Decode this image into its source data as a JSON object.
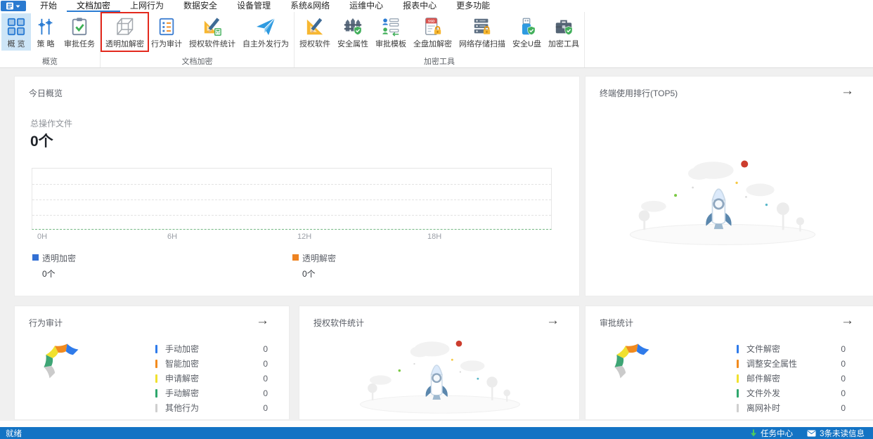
{
  "app": {
    "caret": "▾"
  },
  "menu_tabs": [
    {
      "label": "开始",
      "active": false
    },
    {
      "label": "文档加密",
      "active": true
    },
    {
      "label": "上网行为",
      "active": false
    },
    {
      "label": "数据安全",
      "active": false
    },
    {
      "label": "设备管理",
      "active": false
    },
    {
      "label": "系统&网络",
      "active": false
    },
    {
      "label": "运维中心",
      "active": false
    },
    {
      "label": "报表中心",
      "active": false
    },
    {
      "label": "更多功能",
      "active": false
    }
  ],
  "ribbon": {
    "groups": [
      {
        "label": "概览",
        "items": [
          {
            "label": "概 览",
            "icon": "overview-grid-icon",
            "selected": true
          },
          {
            "label": "策 略",
            "icon": "policy-sliders-icon"
          },
          {
            "label": "审批任务",
            "icon": "approval-task-clipboard-icon"
          }
        ]
      },
      {
        "label": "文档加密",
        "items": [
          {
            "label": "透明加解密",
            "icon": "transparent-crypt-cube-icon",
            "highlighted": true
          },
          {
            "label": "行为审计",
            "icon": "behavior-audit-list-icon"
          },
          {
            "label": "授权软件统计",
            "icon": "licensed-software-stats-icon"
          },
          {
            "label": "自主外发行为",
            "icon": "outgoing-paper-plane-icon"
          }
        ]
      },
      {
        "label": "加密工具",
        "items": [
          {
            "label": "授权软件",
            "icon": "licensed-software-icon"
          },
          {
            "label": "安全属性",
            "icon": "security-attribute-fence-icon"
          },
          {
            "label": "审批模板",
            "icon": "approval-template-icon"
          },
          {
            "label": "全盘加解密",
            "icon": "full-disk-crypt-icon"
          },
          {
            "label": "网络存储扫描",
            "icon": "network-storage-scan-icon"
          },
          {
            "label": "安全U盘",
            "icon": "secure-usb-icon"
          },
          {
            "label": "加密工具",
            "icon": "crypt-toolbox-icon"
          }
        ]
      }
    ]
  },
  "panels": {
    "today": {
      "title": "今日概览",
      "metric_label": "总操作文件",
      "metric_value": "0个",
      "x_ticks": [
        "0H",
        "6H",
        "12H",
        "18H"
      ],
      "legend": [
        {
          "label": "透明加密",
          "value": "0个",
          "color": "#3370d4"
        },
        {
          "label": "透明解密",
          "value": "0个",
          "color": "#ee8322"
        }
      ]
    },
    "terminal_rank": {
      "title": "终端使用排行(TOP5)",
      "arrow": "→"
    },
    "behavior_audit": {
      "title": "行为审计",
      "arrow": "→",
      "legend": [
        {
          "label": "手动加密",
          "value": "0",
          "color": "#2f7bea"
        },
        {
          "label": "智能加密",
          "value": "0",
          "color": "#f28b1e"
        },
        {
          "label": "申请解密",
          "value": "0",
          "color": "#f0e12f"
        },
        {
          "label": "手动解密",
          "value": "0",
          "color": "#2fa76d"
        },
        {
          "label": "其他行为",
          "value": "0",
          "color": "#cfcfcf"
        }
      ]
    },
    "software_stats": {
      "title": "授权软件统计",
      "arrow": "→"
    },
    "approval_stats": {
      "title": "审批统计",
      "arrow": "→",
      "legend": [
        {
          "label": "文件解密",
          "value": "0",
          "color": "#2f7bea"
        },
        {
          "label": "调整安全属性",
          "value": "0",
          "color": "#f28b1e"
        },
        {
          "label": "邮件解密",
          "value": "0",
          "color": "#f0e12f"
        },
        {
          "label": "文件外发",
          "value": "0",
          "color": "#2fa76d"
        },
        {
          "label": "离网补时",
          "value": "0",
          "color": "#cfcfcf"
        }
      ]
    }
  },
  "status_bar": {
    "ready": "就绪",
    "task_center": "任务中心",
    "unread": "3条未读信息"
  },
  "colors": {
    "accent": "#2b7cd3",
    "status_bar": "#1373c4",
    "highlight_box": "#e3291d",
    "selected_item_bg": "#cde5f7",
    "gauge_palette": [
      "#cfcfcf",
      "#2fa76d",
      "#f0e12f",
      "#f28b1e",
      "#2f7bea"
    ]
  },
  "chart_data": [
    {
      "type": "line",
      "title": "今日概览",
      "xlabel": "",
      "ylabel": "",
      "x_ticks": [
        "0H",
        "6H",
        "12H",
        "18H"
      ],
      "x_range": [
        "0H",
        "24H"
      ],
      "grid": true,
      "series": [
        {
          "name": "透明加密",
          "color": "#3370d4",
          "values": [],
          "total": 0
        },
        {
          "name": "透明解密",
          "color": "#ee8322",
          "values": [],
          "total": 0
        }
      ],
      "note": "empty chart, no data plotted"
    },
    {
      "type": "pie",
      "title": "行为审计",
      "subtype": "gauge-arc",
      "legend_position": "right",
      "categories": [
        "手动加密",
        "智能加密",
        "申请解密",
        "手动解密",
        "其他行为"
      ],
      "values": [
        0,
        0,
        0,
        0,
        0
      ],
      "colors": [
        "#2f7bea",
        "#f28b1e",
        "#f0e12f",
        "#2fa76d",
        "#cfcfcf"
      ]
    },
    {
      "type": "pie",
      "title": "审批统计",
      "subtype": "gauge-arc",
      "legend_position": "right",
      "categories": [
        "文件解密",
        "调整安全属性",
        "邮件解密",
        "文件外发",
        "离网补时"
      ],
      "values": [
        0,
        0,
        0,
        0,
        0
      ],
      "colors": [
        "#2f7bea",
        "#f28b1e",
        "#f0e12f",
        "#2fa76d",
        "#cfcfcf"
      ]
    }
  ]
}
